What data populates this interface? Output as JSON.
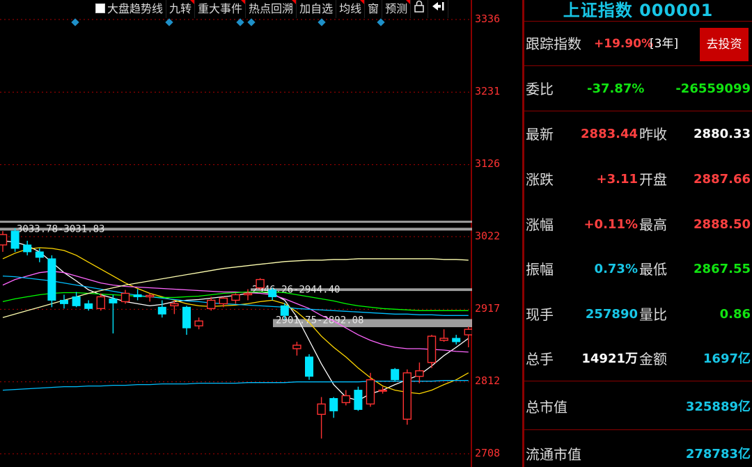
{
  "toolbar": {
    "items": [
      "大盘趋势线",
      "九转",
      "重大事件",
      "热点回溯",
      "加自选",
      "均线",
      "窗",
      "预测"
    ],
    "lock_icon": "lock-icon",
    "exit_icon": "exit-icon"
  },
  "axis": {
    "labels": [
      "3336",
      "3231",
      "3126",
      "3022",
      "2917",
      "2812",
      "2708"
    ],
    "min": 2708,
    "max": 3336
  },
  "annotations": [
    "3033.78-3031.83",
    "2946.26-2944.40",
    "2901.75-2892.08"
  ],
  "panel": {
    "title": "上证指数 000001",
    "track_label": "跟踪指数",
    "track_value": "+19.90%",
    "track_period": "[3年]",
    "invest_button": "去投资",
    "weibi_label": "委比",
    "weibi_pct": "-37.87%",
    "weibi_value": "-26559099",
    "rows": [
      {
        "l1": "最新",
        "v1": "2883.44",
        "l2": "昨收",
        "v2": "2880.33"
      },
      {
        "l1": "涨跌",
        "v1": "+3.11",
        "l2": "开盘",
        "v2": "2887.66"
      },
      {
        "l1": "涨幅",
        "v1": "+0.11%",
        "l2": "最高",
        "v2": "2888.50"
      },
      {
        "l1": "振幅",
        "v1": "0.73%",
        "l2": "最低",
        "v2": "2867.55"
      },
      {
        "l1": "现手",
        "v1": "257890",
        "l2": "量比",
        "v2": "0.86"
      },
      {
        "l1": "总手",
        "v1": "14921万",
        "l2": "金额",
        "v2": "1697亿"
      }
    ],
    "total_mv_label": "总市值",
    "total_mv": "325889亿",
    "float_mv_label": "流通市值",
    "float_mv": "278783亿"
  },
  "colors": {
    "up": "#ff3232",
    "down": "#00e5ff",
    "ma5": "#ffffff",
    "ma10": "#ffd700",
    "ma20": "#ff66ff",
    "ma30": "#00ff00",
    "ma60": "#00bfff",
    "ma120": "#ffffb0"
  },
  "chart_data": {
    "type": "candlestick",
    "ylim": [
      2708,
      3336
    ],
    "candles": [
      {
        "o": 3010,
        "h": 3030,
        "l": 3000,
        "c": 3025
      },
      {
        "o": 3030,
        "h": 3034,
        "l": 3000,
        "c": 3005
      },
      {
        "o": 3010,
        "h": 3016,
        "l": 2995,
        "c": 3000
      },
      {
        "o": 3000,
        "h": 3005,
        "l": 2985,
        "c": 2992
      },
      {
        "o": 2990,
        "h": 2995,
        "l": 2920,
        "c": 2930
      },
      {
        "o": 2930,
        "h": 2938,
        "l": 2918,
        "c": 2925
      },
      {
        "o": 2935,
        "h": 2942,
        "l": 2920,
        "c": 2922
      },
      {
        "o": 2925,
        "h": 2930,
        "l": 2915,
        "c": 2918
      },
      {
        "o": 2918,
        "h": 2940,
        "l": 2915,
        "c": 2935
      },
      {
        "o": 2932,
        "h": 2938,
        "l": 2882,
        "c": 2926
      },
      {
        "o": 2928,
        "h": 2945,
        "l": 2925,
        "c": 2940
      },
      {
        "o": 2938,
        "h": 2946,
        "l": 2930,
        "c": 2935
      },
      {
        "o": 2935,
        "h": 2940,
        "l": 2928,
        "c": 2937
      },
      {
        "o": 2920,
        "h": 2930,
        "l": 2905,
        "c": 2910
      },
      {
        "o": 2922,
        "h": 2930,
        "l": 2910,
        "c": 2925
      },
      {
        "o": 2920,
        "h": 2922,
        "l": 2880,
        "c": 2890
      },
      {
        "o": 2893,
        "h": 2905,
        "l": 2888,
        "c": 2900
      },
      {
        "o": 2918,
        "h": 2935,
        "l": 2915,
        "c": 2930
      },
      {
        "o": 2925,
        "h": 2935,
        "l": 2920,
        "c": 2933
      },
      {
        "o": 2930,
        "h": 2940,
        "l": 2925,
        "c": 2938
      },
      {
        "o": 2938,
        "h": 2946,
        "l": 2930,
        "c": 2940
      },
      {
        "o": 2948,
        "h": 2962,
        "l": 2945,
        "c": 2960
      },
      {
        "o": 2945,
        "h": 2948,
        "l": 2930,
        "c": 2935
      },
      {
        "o": 2922,
        "h": 2926,
        "l": 2902,
        "c": 2908
      },
      {
        "o": 2860,
        "h": 2870,
        "l": 2850,
        "c": 2865
      },
      {
        "o": 2848,
        "h": 2852,
        "l": 2815,
        "c": 2820
      },
      {
        "o": 2765,
        "h": 2790,
        "l": 2730,
        "c": 2780
      },
      {
        "o": 2788,
        "h": 2790,
        "l": 2760,
        "c": 2770
      },
      {
        "o": 2782,
        "h": 2800,
        "l": 2778,
        "c": 2792
      },
      {
        "o": 2800,
        "h": 2805,
        "l": 2770,
        "c": 2772
      },
      {
        "o": 2780,
        "h": 2825,
        "l": 2776,
        "c": 2815
      },
      {
        "o": 2800,
        "h": 2805,
        "l": 2795,
        "c": 2800
      },
      {
        "o": 2830,
        "h": 2832,
        "l": 2812,
        "c": 2815
      },
      {
        "o": 2758,
        "h": 2830,
        "l": 2750,
        "c": 2825
      },
      {
        "o": 2820,
        "h": 2840,
        "l": 2810,
        "c": 2828
      },
      {
        "o": 2840,
        "h": 2880,
        "l": 2832,
        "c": 2878
      },
      {
        "o": 2872,
        "h": 2888,
        "l": 2870,
        "c": 2875
      },
      {
        "o": 2875,
        "h": 2880,
        "l": 2866,
        "c": 2870
      },
      {
        "o": 2880,
        "h": 2892,
        "l": 2862,
        "c": 2888
      }
    ],
    "ma": {
      "ma5": [
        3016,
        3014,
        3009,
        3000,
        2985,
        2970,
        2958,
        2945,
        2938,
        2933,
        2928,
        2925,
        2922,
        2924,
        2928,
        2930,
        2931,
        2933,
        2935,
        2937,
        2940,
        2942,
        2940,
        2930,
        2906,
        2872,
        2838,
        2808,
        2790,
        2785,
        2795,
        2800,
        2808,
        2815,
        2822,
        2835,
        2850,
        2862,
        2875
      ],
      "ma10": [
        2990,
        2998,
        3004,
        3006,
        3005,
        3002,
        2995,
        2985,
        2975,
        2965,
        2955,
        2947,
        2940,
        2935,
        2930,
        2925,
        2922,
        2921,
        2922,
        2923,
        2925,
        2928,
        2930,
        2925,
        2913,
        2898,
        2878,
        2862,
        2848,
        2832,
        2818,
        2806,
        2800,
        2797,
        2795,
        2800,
        2808,
        2815,
        2825
      ],
      "ma20": [
        2952,
        2960,
        2965,
        2970,
        2972,
        2970,
        2965,
        2960,
        2955,
        2952,
        2950,
        2949,
        2948,
        2947,
        2946,
        2945,
        2944,
        2943,
        2942,
        2942,
        2941,
        2940,
        2938,
        2932,
        2925,
        2918,
        2908,
        2900,
        2890,
        2880,
        2872,
        2866,
        2862,
        2860,
        2860,
        2859,
        2858,
        2856,
        2855
      ],
      "ma30": [
        2928,
        2932,
        2935,
        2938,
        2940,
        2941,
        2941,
        2940,
        2939,
        2938,
        2937,
        2936,
        2935,
        2934,
        2934,
        2935,
        2936,
        2938,
        2940,
        2941,
        2942,
        2942,
        2942,
        2941,
        2938,
        2935,
        2932,
        2929,
        2925,
        2922,
        2920,
        2918,
        2917,
        2916,
        2915,
        2915,
        2915,
        2915,
        2915
      ],
      "ma60": [
        2965,
        2964,
        2962,
        2960,
        2958,
        2955,
        2952,
        2949,
        2946,
        2943,
        2940,
        2937,
        2935,
        2933,
        2931,
        2929,
        2928,
        2926,
        2925,
        2924,
        2923,
        2922,
        2921,
        2920,
        2918,
        2917,
        2916,
        2915,
        2914,
        2913,
        2912,
        2911,
        2910,
        2910,
        2909,
        2909,
        2908,
        2908,
        2908
      ],
      "ma120": [
        2905,
        2910,
        2915,
        2920,
        2925,
        2930,
        2935,
        2940,
        2944,
        2948,
        2952,
        2955,
        2958,
        2961,
        2964,
        2967,
        2970,
        2973,
        2976,
        2978,
        2980,
        2982,
        2984,
        2986,
        2987,
        2988,
        2988,
        2989,
        2989,
        2990,
        2990,
        2990,
        2990,
        2990,
        2990,
        2990,
        2989,
        2989,
        2988
      ],
      "long": [
        2800,
        2801,
        2802,
        2803,
        2804,
        2805,
        2805,
        2806,
        2806,
        2807,
        2807,
        2808,
        2808,
        2809,
        2809,
        2809,
        2810,
        2810,
        2810,
        2810,
        2811,
        2811,
        2811,
        2811,
        2812,
        2812,
        2812,
        2812,
        2812,
        2812,
        2813,
        2813,
        2813,
        2813,
        2813,
        2813,
        2814,
        2814,
        2814
      ]
    }
  }
}
